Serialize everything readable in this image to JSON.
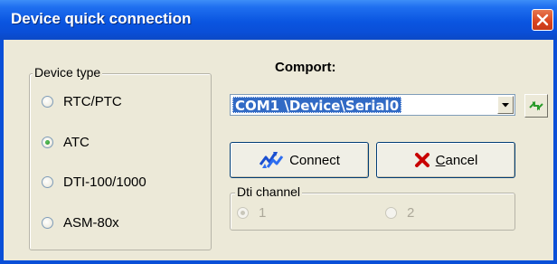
{
  "window": {
    "title": "Device quick connection"
  },
  "device_type": {
    "legend": "Device type",
    "options": [
      {
        "label": "RTC/PTC",
        "checked": false
      },
      {
        "label": "ATC",
        "checked": true
      },
      {
        "label": "DTI-100/1000",
        "checked": false
      },
      {
        "label": "ASM-80x",
        "checked": false
      }
    ]
  },
  "comport": {
    "label": "Comport:",
    "selected": "COM1 \\Device\\Serial0"
  },
  "buttons": {
    "connect": "Connect",
    "cancel_first": "C",
    "cancel_rest": "ancel"
  },
  "dti_channel": {
    "legend": "Dti channel",
    "options": [
      {
        "label": "1",
        "checked": true,
        "enabled": false
      },
      {
        "label": "2",
        "checked": false,
        "enabled": false
      }
    ]
  },
  "icons": {
    "close": "close-icon",
    "refresh": "refresh-icon",
    "connect": "connect-icon",
    "cancel": "cancel-x-icon",
    "dropdown": "chevron-down-icon"
  },
  "colors": {
    "titlebar": "#0a4fd8",
    "selection": "#316ac5",
    "close": "#d9431e",
    "cancel_x": "#c80000",
    "connect_icon": "#1a4fd0"
  }
}
